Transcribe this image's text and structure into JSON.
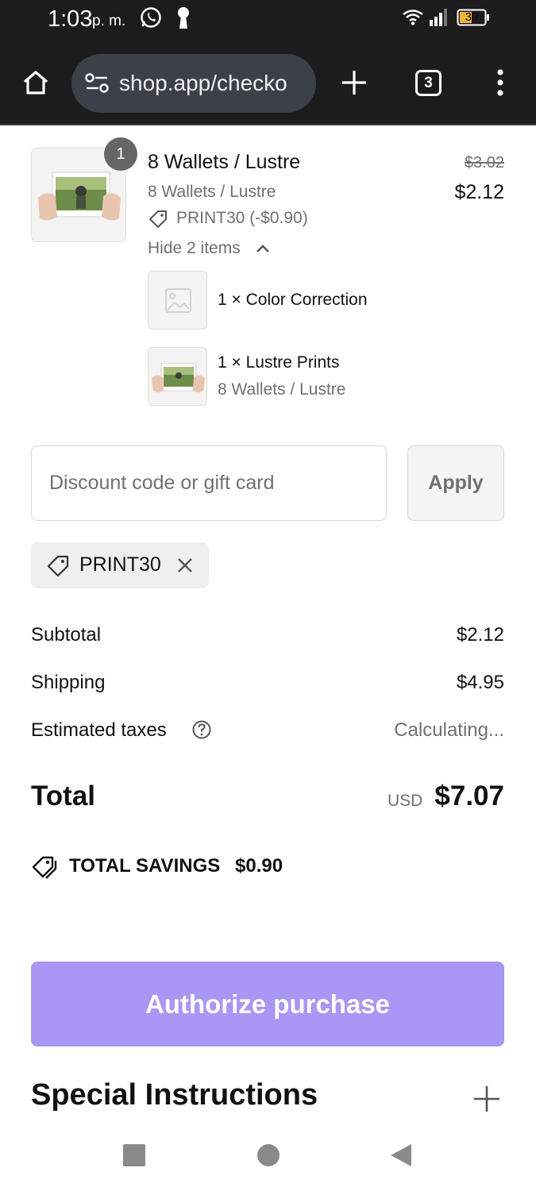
{
  "status_bar": {
    "time": "1:03",
    "ampm": "p. m.",
    "battery": "39",
    "icons": [
      "whatsapp-icon",
      "keyhole-icon",
      "wifi-icon",
      "signal-icon",
      "battery-icon"
    ]
  },
  "browser": {
    "url": "shop.app/checko",
    "tab_count": "3",
    "icons": [
      "home-icon",
      "site-settings-icon",
      "new-tab-icon",
      "tab-switcher-icon",
      "menu-icon"
    ]
  },
  "order": {
    "item": {
      "quantity_badge": "1",
      "title": "8 Wallets / Lustre",
      "variant": "8 Wallets / Lustre",
      "discount": "PRINT30 (-$0.90)",
      "original_price": "$3.02",
      "price": "$2.12",
      "toggle_label": "Hide 2 items"
    },
    "sub_items": [
      {
        "label": "1 × Color Correction",
        "variant": ""
      },
      {
        "label": "1 × Lustre Prints",
        "variant": "8 Wallets / Lustre"
      }
    ]
  },
  "discount": {
    "placeholder": "Discount code or gift card",
    "apply_label": "Apply",
    "applied_code": "PRINT30"
  },
  "summary": {
    "subtotal_label": "Subtotal",
    "subtotal_value": "$2.12",
    "shipping_label": "Shipping",
    "shipping_value": "$4.95",
    "taxes_label": "Estimated taxes",
    "taxes_value": "Calculating...",
    "total_label": "Total",
    "currency": "USD",
    "total_value": "$7.07",
    "savings_label": "TOTAL SAVINGS",
    "savings_value": "$0.90"
  },
  "actions": {
    "authorize_label": "Authorize purchase"
  },
  "special_instructions": {
    "title": "Special Instructions"
  },
  "colors": {
    "accent": "#a897f5",
    "muted_text": "#707070",
    "browser_bg": "#1c1c1c"
  }
}
